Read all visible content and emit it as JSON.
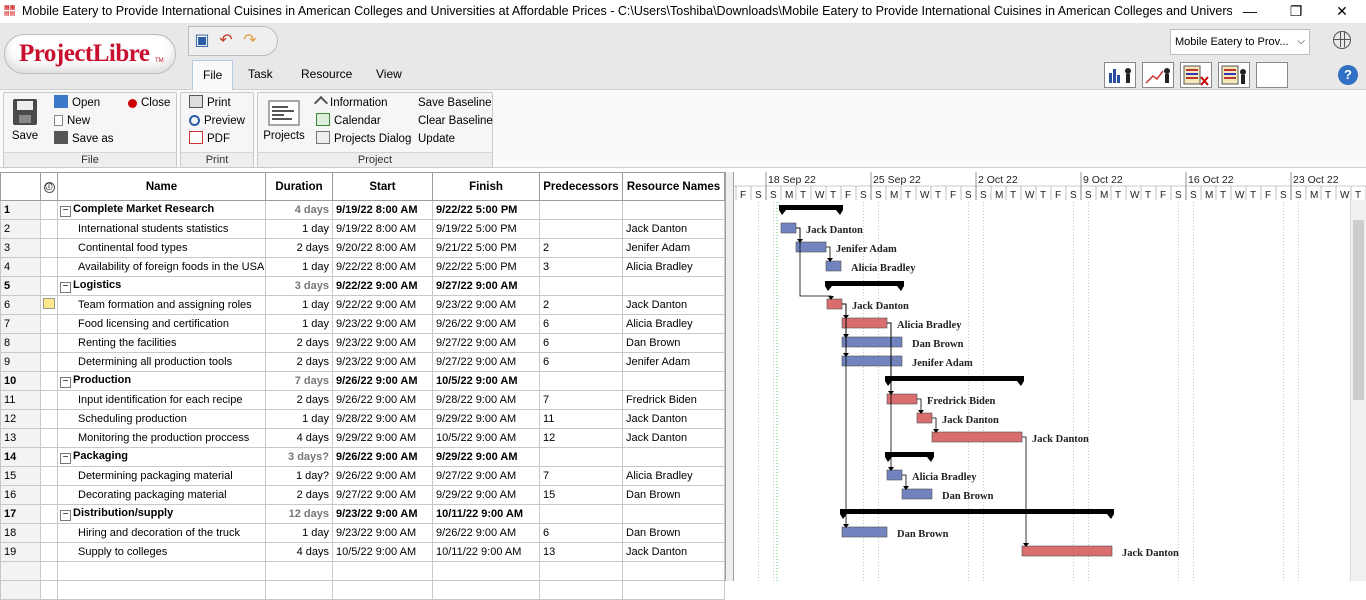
{
  "window": {
    "title": "Mobile Eatery to Provide International Cuisines in American Colleges and Universities at Affordable Prices - C:\\Users\\Toshiba\\Downloads\\Mobile Eatery to Provide International Cuisines in American Colleges and Universities at A...",
    "minimize": "—",
    "maximize": "❐",
    "close": "✕"
  },
  "app": {
    "logo": "ProjectLibre",
    "logo_tm": "TM"
  },
  "tabs": [
    "File",
    "Task",
    "Resource",
    "View"
  ],
  "active_tab": "File",
  "project_selector": "Mobile Eatery to Prov...",
  "ribbon": {
    "file": {
      "label": "File",
      "save": "Save",
      "open": "Open",
      "close": "Close",
      "new": "New",
      "save_as": "Save as"
    },
    "print": {
      "label": "Print",
      "print": "Print",
      "preview": "Preview",
      "pdf": "PDF"
    },
    "project": {
      "label": "Project",
      "projects": "Projects",
      "information": "Information",
      "calendar": "Calendar",
      "projects_dialog": "Projects Dialog",
      "save_baseline": "Save Baseline",
      "clear_baseline": "Clear Baseline",
      "update": "Update"
    }
  },
  "grid": {
    "columns": [
      "",
      "",
      "Name",
      "Duration",
      "Start",
      "Finish",
      "Predecessors",
      "Resource Names"
    ],
    "rows": [
      {
        "id": "1",
        "name": "Complete Market Research",
        "duration": "4 days",
        "start": "9/19/22 8:00 AM",
        "finish": "9/22/22 5:00 PM",
        "pred": "",
        "res": "",
        "summary": true
      },
      {
        "id": "2",
        "name": "International students statistics",
        "duration": "1 day",
        "start": "9/19/22 8:00 AM",
        "finish": "9/19/22 5:00 PM",
        "pred": "",
        "res": "Jack Danton",
        "summary": false
      },
      {
        "id": "3",
        "name": "Continental food types",
        "duration": "2 days",
        "start": "9/20/22 8:00 AM",
        "finish": "9/21/22 5:00 PM",
        "pred": "2",
        "res": "Jenifer Adam",
        "summary": false
      },
      {
        "id": "4",
        "name": "Availability of foreign foods in the USA",
        "duration": "1 day",
        "start": "9/22/22 8:00 AM",
        "finish": "9/22/22 5:00 PM",
        "pred": "3",
        "res": "Alicia Bradley",
        "summary": false
      },
      {
        "id": "5",
        "name": "Logistics",
        "duration": "3 days",
        "start": "9/22/22 9:00 AM",
        "finish": "9/27/22 9:00 AM",
        "pred": "",
        "res": "",
        "summary": true
      },
      {
        "id": "6",
        "name": "Team formation and assigning roles",
        "duration": "1 day",
        "start": "9/22/22 9:00 AM",
        "finish": "9/23/22 9:00 AM",
        "pred": "2",
        "res": "Jack Danton",
        "summary": false,
        "note": true
      },
      {
        "id": "7",
        "name": "Food licensing and certification",
        "duration": "1 day",
        "start": "9/23/22 9:00 AM",
        "finish": "9/26/22 9:00 AM",
        "pred": "6",
        "res": "Alicia Bradley",
        "summary": false
      },
      {
        "id": "8",
        "name": "Renting the facilities",
        "duration": "2 days",
        "start": "9/23/22 9:00 AM",
        "finish": "9/27/22 9:00 AM",
        "pred": "6",
        "res": "Dan Brown",
        "summary": false
      },
      {
        "id": "9",
        "name": "Determining all production tools",
        "duration": "2 days",
        "start": "9/23/22 9:00 AM",
        "finish": "9/27/22 9:00 AM",
        "pred": "6",
        "res": "Jenifer Adam",
        "summary": false
      },
      {
        "id": "10",
        "name": "Production",
        "duration": "7 days",
        "start": "9/26/22 9:00 AM",
        "finish": "10/5/22 9:00 AM",
        "pred": "",
        "res": "",
        "summary": true
      },
      {
        "id": "11",
        "name": "Input identification for each recipe",
        "duration": "2 days",
        "start": "9/26/22 9:00 AM",
        "finish": "9/28/22 9:00 AM",
        "pred": "7",
        "res": "Fredrick Biden",
        "summary": false
      },
      {
        "id": "12",
        "name": "Scheduling production",
        "duration": "1 day",
        "start": "9/28/22 9:00 AM",
        "finish": "9/29/22 9:00 AM",
        "pred": "11",
        "res": "Jack Danton",
        "summary": false
      },
      {
        "id": "13",
        "name": "Monitoring the production proccess",
        "duration": "4 days",
        "start": "9/29/22 9:00 AM",
        "finish": "10/5/22 9:00 AM",
        "pred": "12",
        "res": "Jack Danton",
        "summary": false
      },
      {
        "id": "14",
        "name": "Packaging",
        "duration": "3 days?",
        "start": "9/26/22 9:00 AM",
        "finish": "9/29/22 9:00 AM",
        "pred": "",
        "res": "",
        "summary": true
      },
      {
        "id": "15",
        "name": "Determining packaging material",
        "duration": "1 day?",
        "start": "9/26/22 9:00 AM",
        "finish": "9/27/22 9:00 AM",
        "pred": "7",
        "res": "Alicia Bradley",
        "summary": false
      },
      {
        "id": "16",
        "name": "Decorating packaging material",
        "duration": "2 days",
        "start": "9/27/22 9:00 AM",
        "finish": "9/29/22 9:00 AM",
        "pred": "15",
        "res": "Dan Brown",
        "summary": false
      },
      {
        "id": "17",
        "name": "Distribution/supply",
        "duration": "12 days",
        "start": "9/23/22 9:00 AM",
        "finish": "10/11/22 9:00 AM",
        "pred": "",
        "res": "",
        "summary": true
      },
      {
        "id": "18",
        "name": "Hiring and decoration of the truck",
        "duration": "1 day",
        "start": "9/23/22 9:00 AM",
        "finish": "9/26/22 9:00 AM",
        "pred": "6",
        "res": "Dan Brown",
        "summary": false
      },
      {
        "id": "19",
        "name": "Supply to colleges",
        "duration": "4 days",
        "start": "10/5/22 9:00 AM",
        "finish": "10/11/22 9:00 AM",
        "pred": "13",
        "res": "Jack Danton",
        "summary": false
      }
    ]
  },
  "gantt": {
    "weeks": [
      "18 Sep 22",
      "25 Sep 22",
      "2 Oct 22",
      "9 Oct 22",
      "16 Oct 22",
      "23 Oct 22"
    ],
    "days": [
      "F",
      "S",
      "S",
      "M",
      "T",
      "W",
      "T",
      "F",
      "S",
      "S",
      "M",
      "T",
      "W",
      "T",
      "F",
      "S",
      "S",
      "M",
      "T",
      "W",
      "T",
      "F",
      "S",
      "S",
      "M",
      "T",
      "W",
      "T",
      "F",
      "S",
      "S",
      "M",
      "T",
      "W",
      "T",
      "F",
      "S",
      "S",
      "M",
      "T",
      "W",
      "T",
      "F",
      "S",
      "S",
      "M",
      "T",
      "W"
    ],
    "colors": {
      "critical": "#d25555",
      "normal": "#5a6fb5",
      "summary": "#000000"
    }
  }
}
